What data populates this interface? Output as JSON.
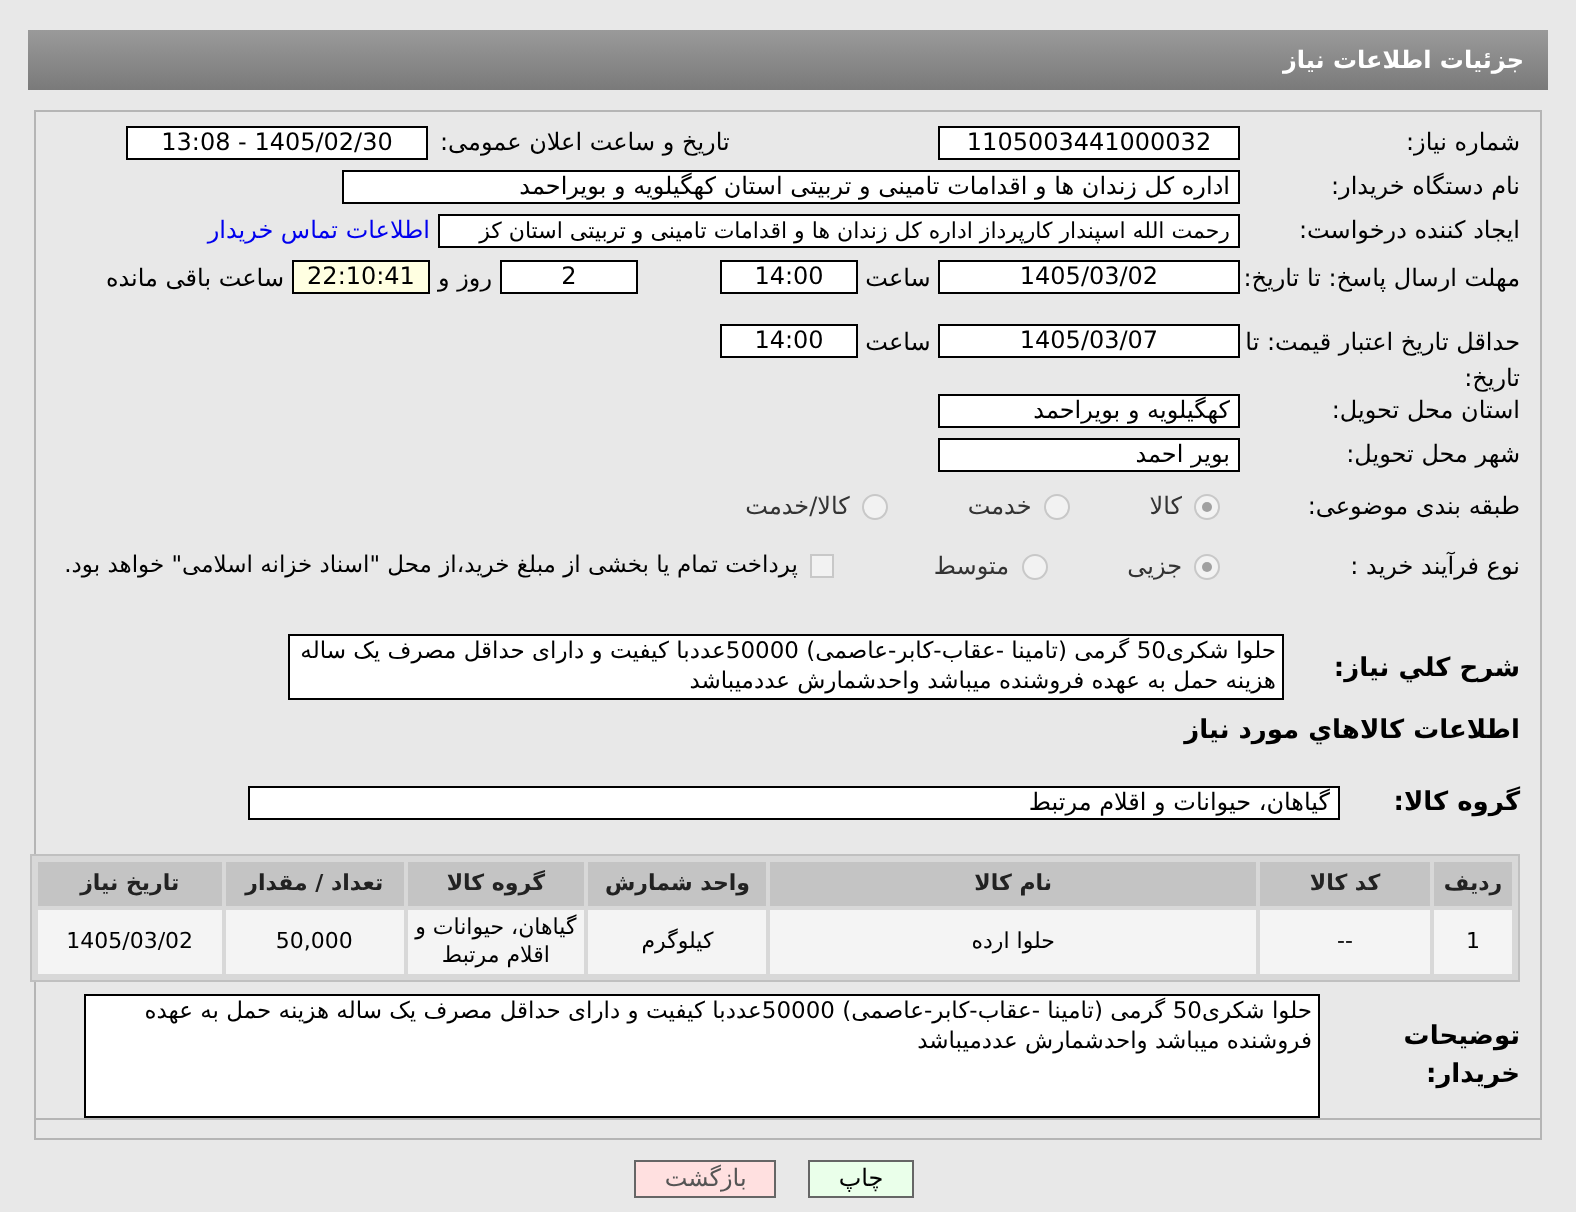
{
  "header": {
    "title": "جزئیات اطلاعات نیاز"
  },
  "need_number": {
    "label": "شماره نیاز:",
    "value": "1105003441000032"
  },
  "announce": {
    "label": "تاریخ و ساعت اعلان عمومی:",
    "value": "1405/02/30 - 13:08"
  },
  "buyer_org": {
    "label": "نام دستگاه خریدار:",
    "value": "اداره کل زندان ها و اقدامات تامینی و تربیتی استان کهگیلویه و بویراحمد"
  },
  "creator": {
    "label": "ایجاد کننده درخواست:",
    "value": "رحمت الله اسپندار کارپرداز اداره کل زندان ها و اقدامات تامینی و تربیتی استان کز",
    "link": "اطلاعات تماس خریدار"
  },
  "deadline": {
    "label": "مهلت ارسال پاسخ: تا تاریخ:",
    "date": "1405/03/02",
    "time_label": "ساعت",
    "time": "14:00",
    "days": "2",
    "days_label": "روز و",
    "remaining": "22:10:41",
    "remaining_label": "ساعت باقی مانده"
  },
  "validity": {
    "label": "حداقل تاریخ اعتبار قیمت: تا تاریخ:",
    "date": "1405/03/07",
    "time_label": "ساعت",
    "time": "14:00"
  },
  "province": {
    "label": "استان محل تحویل:",
    "value": "کهگیلویه و بویراحمد"
  },
  "city": {
    "label": "شهر محل تحویل:",
    "value": "بویر احمد"
  },
  "category": {
    "label": "طبقه بندی موضوعی:",
    "options": [
      {
        "label": "کالا",
        "selected": true
      },
      {
        "label": "خدمت",
        "selected": false
      },
      {
        "label": "کالا/خدمت",
        "selected": false
      }
    ]
  },
  "process": {
    "label": "نوع فرآیند خرید :",
    "options": [
      {
        "label": "جزیی",
        "selected": true
      },
      {
        "label": "متوسط",
        "selected": false
      }
    ],
    "payment": {
      "label": "پرداخت تمام یا بخشی از مبلغ خرید،از محل \"اسناد خزانه اسلامی\" خواهد بود.",
      "checked": false
    }
  },
  "summary": {
    "label": "شرح کلي نياز:",
    "value": "حلوا شکری50 گرمی (تامینا -عقاب-کابر-عاصمی) 50000عددبا کیفیت و دارای حداقل مصرف یک ساله هزینه حمل به عهده فروشنده میباشد  واحدشمارش عددمیباشد"
  },
  "goods_title": "اطلاعات کالاهاي مورد نياز",
  "goods_group": {
    "label": "گروه کالا:",
    "value": "گیاهان، حیوانات و اقلام مرتبط"
  },
  "table": {
    "columns": [
      "ردیف",
      "کد کالا",
      "نام کالا",
      "واحد شمارش",
      "گروه کالا",
      "تعداد / مقدار",
      "تاریخ نیاز"
    ],
    "rows": [
      [
        "1",
        "--",
        "حلوا ارده",
        "کیلوگرم",
        "گیاهان، حیوانات و اقلام مرتبط",
        "50,000",
        "1405/03/02"
      ]
    ]
  },
  "buyer_notes": {
    "label": "توضیحات خریدار:",
    "value": "حلوا شکری50 گرمی (تامینا -عقاب-کابر-عاصمی) 50000عددبا کیفیت و دارای حداقل مصرف یک ساله هزینه حمل به عهده فروشنده میباشد  واحدشمارش عددمیباشد"
  },
  "buttons": [
    {
      "label": "چاپ",
      "kind": "print"
    },
    {
      "label": "بازگشت",
      "kind": "back"
    }
  ]
}
